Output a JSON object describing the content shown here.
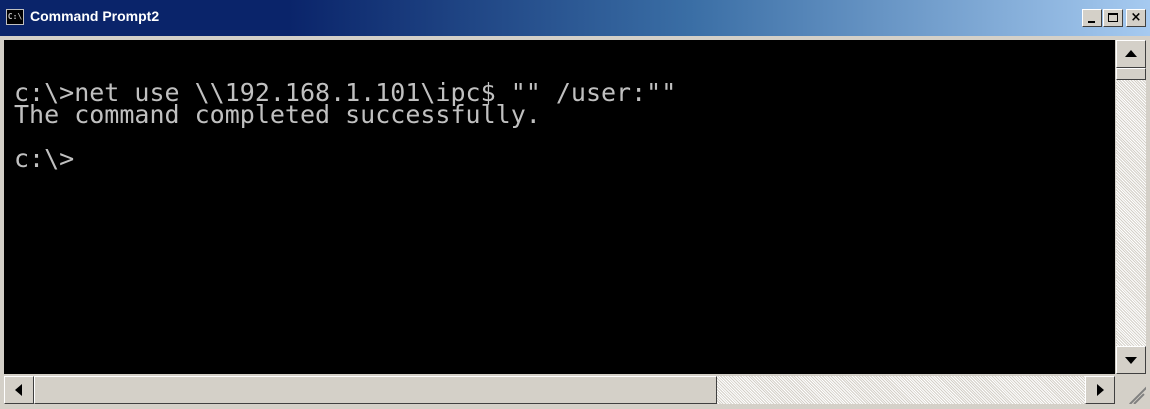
{
  "window": {
    "title": "Command Prompt2",
    "icon": "console-icon",
    "icon_text": "C:\\",
    "buttons": [
      {
        "name": "minimize-button",
        "icon": "minimize-icon"
      },
      {
        "name": "maximize-button",
        "icon": "maximize-icon"
      },
      {
        "name": "close-button",
        "icon": "close-icon",
        "label": "×"
      }
    ]
  },
  "console": {
    "lines": [
      "c:\\>net use \\\\192.168.1.101\\ipc$ \"\" /user:\"\"",
      "The command completed successfully.",
      "",
      "c:\\>"
    ],
    "text_color": "#c0c0c0",
    "background_color": "#000000"
  },
  "scrollbars": {
    "vertical": {
      "up_icon": "arrow-up-icon",
      "down_icon": "arrow-down-icon"
    },
    "horizontal": {
      "left_icon": "arrow-left-icon",
      "right_icon": "arrow-right-icon",
      "thumb_fraction": 0.65
    }
  },
  "colors": {
    "titlebar_start": "#0a246a",
    "titlebar_end": "#a6caf0",
    "chrome": "#d4d0c8"
  }
}
